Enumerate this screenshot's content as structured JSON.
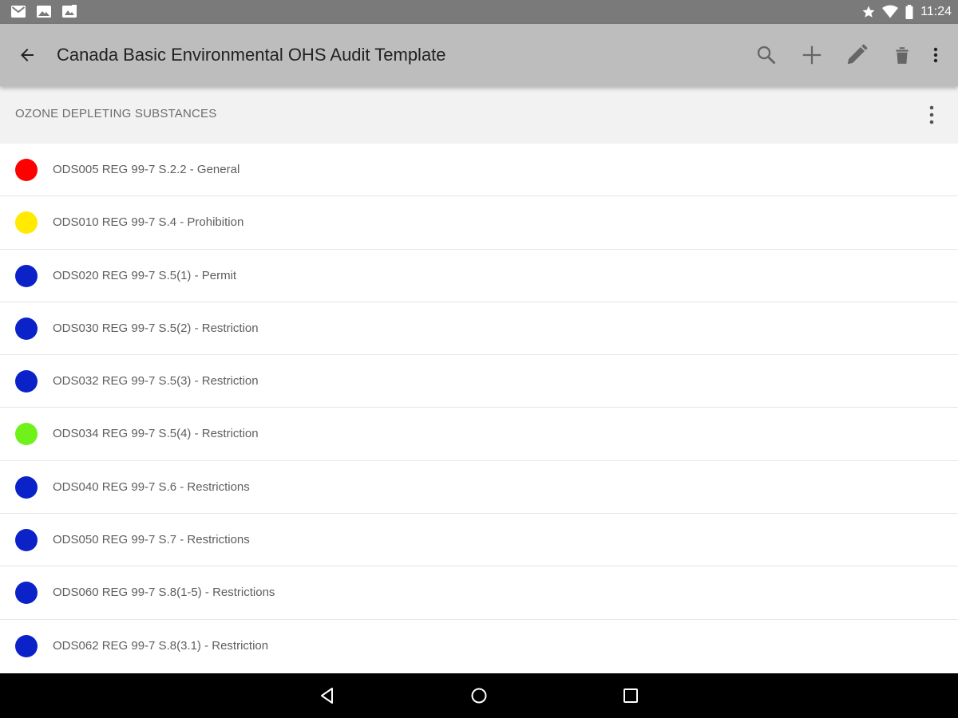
{
  "status_bar": {
    "left_icons": [
      "gmail-icon",
      "gallery-icon",
      "photos-icon"
    ],
    "right_icons": [
      "star-icon",
      "wifi-icon",
      "battery-icon"
    ],
    "time": "11:24"
  },
  "toolbar": {
    "title": "Canada Basic Environmental OHS Audit Template",
    "actions": [
      "search-icon",
      "add-icon",
      "edit-icon",
      "delete-icon",
      "overflow-menu-icon"
    ],
    "background": "#bdbdbd"
  },
  "section": {
    "title": "OZONE DEPLETING SUBSTANCES"
  },
  "items": [
    {
      "label": "ODS005 REG 99-7 S.2.2 - General",
      "status_color": "#ff0000"
    },
    {
      "label": "ODS010 REG 99-7 S.4 - Prohibition",
      "status_color": "#ffea00"
    },
    {
      "label": "ODS020 REG 99-7 S.5(1) - Permit",
      "status_color": "#0a22c8"
    },
    {
      "label": "ODS030 REG 99-7 S.5(2) - Restriction",
      "status_color": "#0a22c8"
    },
    {
      "label": "ODS032 REG 99-7 S.5(3) - Restriction",
      "status_color": "#0a22c8"
    },
    {
      "label": "ODS034 REG 99-7 S.5(4) - Restriction",
      "status_color": "#6ff21a"
    },
    {
      "label": "ODS040 REG 99-7 S.6 - Restrictions",
      "status_color": "#0a22c8"
    },
    {
      "label": "ODS050 REG 99-7 S.7 - Restrictions",
      "status_color": "#0a22c8"
    },
    {
      "label": "ODS060 REG 99-7 S.8(1-5) - Restrictions",
      "status_color": "#0a22c8"
    },
    {
      "label": "ODS062 REG 99-7 S.8(3.1) - Restriction",
      "status_color": "#0a22c8"
    }
  ],
  "nav_bar": {
    "buttons": [
      "back-triangle-icon",
      "home-circle-icon",
      "recents-square-icon"
    ]
  }
}
